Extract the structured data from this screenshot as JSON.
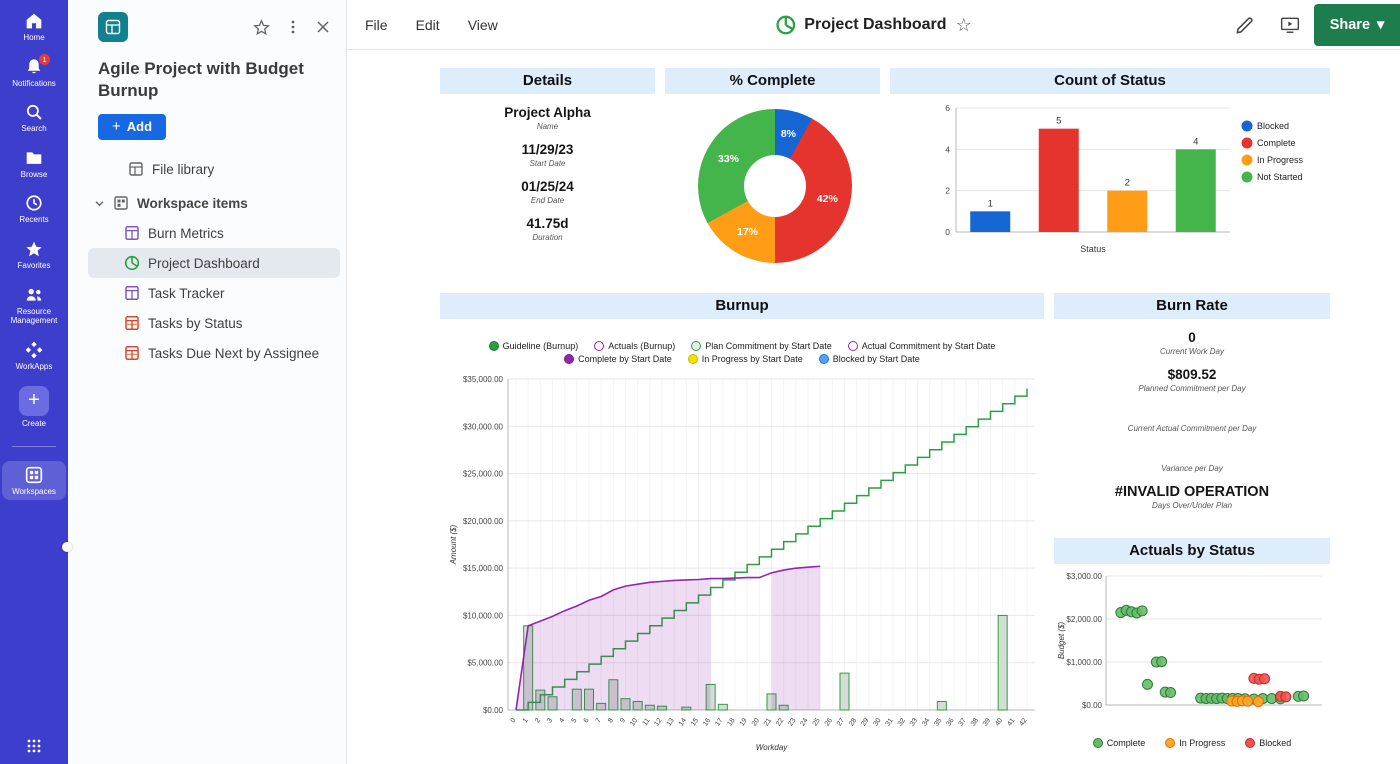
{
  "app": {
    "menu": [
      "File",
      "Edit",
      "View"
    ],
    "doc_title": "Project Dashboard",
    "share_label": "Share"
  },
  "rail": {
    "items": [
      {
        "id": "home",
        "label": "Home"
      },
      {
        "id": "notifications",
        "label": "Notifications",
        "badge": "1"
      },
      {
        "id": "search",
        "label": "Search"
      },
      {
        "id": "browse",
        "label": "Browse"
      },
      {
        "id": "recents",
        "label": "Recents"
      },
      {
        "id": "favorites",
        "label": "Favorites"
      },
      {
        "id": "resource-management",
        "label": "Resource Management"
      },
      {
        "id": "workapps",
        "label": "WorkApps"
      },
      {
        "id": "create",
        "label": "Create"
      },
      {
        "id": "workspaces",
        "label": "Workspaces"
      }
    ]
  },
  "sidebar": {
    "title": "Agile Project with Budget Burnup",
    "add_label": "Add",
    "file_library": "File library",
    "workspace_items_label": "Workspace items",
    "items": [
      {
        "label": "Burn Metrics",
        "type": "sheet"
      },
      {
        "label": "Project Dashboard",
        "type": "dashboard",
        "selected": true
      },
      {
        "label": "Task Tracker",
        "type": "sheet"
      },
      {
        "label": "Tasks by Status",
        "type": "report"
      },
      {
        "label": "Tasks Due Next by Assignee",
        "type": "report"
      }
    ]
  },
  "widgets": {
    "details": {
      "title": "Details",
      "rows": [
        {
          "value": "Project Alpha",
          "label": "Name"
        },
        {
          "value": "11/29/23",
          "label": "Start Date"
        },
        {
          "value": "01/25/24",
          "label": "End Date"
        },
        {
          "value": "41.75d",
          "label": "Duration"
        }
      ]
    },
    "percent_complete": {
      "title": "% Complete"
    },
    "count_of_status": {
      "title": "Count of Status"
    },
    "burnup": {
      "title": "Burnup"
    },
    "burn_rate": {
      "title": "Burn Rate",
      "rows": [
        {
          "value": "0",
          "label": "Current Work Day"
        },
        {
          "value": "$809.52",
          "label": "Planned Commitment per Day"
        },
        {
          "value": "",
          "label": "Current Actual Commitment per Day"
        },
        {
          "value": "",
          "label": "Variance per Day"
        },
        {
          "value": "#INVALID OPERATION",
          "label": "Days Over/Under Plan"
        }
      ]
    },
    "actuals_by_status": {
      "title": "Actuals by Status"
    }
  },
  "colors": {
    "accent_blue": "#1668e3",
    "share_green": "#1d7d4d",
    "rail_indigo": "#3e3ecd",
    "widget_header_bg": "#ddedfc"
  },
  "chart_data": [
    {
      "id": "percent-complete",
      "type": "pie",
      "title": "% Complete",
      "donut": true,
      "slices": [
        {
          "label": "8%",
          "value": 8,
          "color": "#1565d2"
        },
        {
          "label": "42%",
          "value": 42,
          "color": "#e5332d"
        },
        {
          "label": "17%",
          "value": 17,
          "color": "#ff9e16"
        },
        {
          "label": "33%",
          "value": 33,
          "color": "#43b54a"
        }
      ]
    },
    {
      "id": "count-of-status",
      "type": "bar",
      "title": "Count of Status",
      "categories": [
        "Blocked",
        "Complete",
        "In Progress",
        "Not Started"
      ],
      "values": [
        1,
        5,
        2,
        4
      ],
      "colors": [
        "#1565d2",
        "#e5332d",
        "#ff9e16",
        "#43b54a"
      ],
      "xlabel": "Status",
      "ylim": [
        0,
        6
      ],
      "yticks": [
        0,
        2,
        4,
        6
      ],
      "legend_position": "right",
      "legend": [
        {
          "label": "Blocked",
          "fill": "#1565d2",
          "stroke": "#0d4ea8"
        },
        {
          "label": "Complete",
          "fill": "#e5332d",
          "stroke": "#b02420"
        },
        {
          "label": "In Progress",
          "fill": "#ff9e16",
          "stroke": "#d07f08"
        },
        {
          "label": "Not Started",
          "fill": "#43b54a",
          "stroke": "#2e8a36"
        }
      ]
    },
    {
      "id": "burnup",
      "type": "line",
      "title": "Burnup",
      "xlabel": "Workday",
      "ylabel": "Amount ($)",
      "xlim": [
        0,
        42
      ],
      "ylim": [
        0,
        35000
      ],
      "ytick_step": 5000,
      "legend": [
        {
          "label": "Guideline (Burnup)",
          "fill": "#2e9e44",
          "stroke": "#1b7a30"
        },
        {
          "label": "Actuals (Burnup)",
          "fill": "#ffffff",
          "stroke": "#9127b0"
        },
        {
          "label": "Plan Commitment by Start Date",
          "fill": "#e7efe7",
          "stroke": "#2e9e44"
        },
        {
          "label": "Actual Commitment by Start Date",
          "fill": "#ffffff",
          "stroke": "#9127b0"
        },
        {
          "label": "Complete by Start Date",
          "fill": "#9127b0",
          "stroke": "#731f8d"
        },
        {
          "label": "In Progress by Start Date",
          "fill": "#f7df00",
          "stroke": "#cdb900"
        },
        {
          "label": "Blocked by Start Date",
          "fill": "#4da3f5",
          "stroke": "#1e78d2"
        }
      ],
      "series": [
        {
          "name": "Guideline (Burnup)",
          "style": "step",
          "color": "#2e9e44",
          "points": [
            [
              0,
              0
            ],
            [
              42,
              34000
            ]
          ]
        },
        {
          "name": "Actuals (Burnup)",
          "style": "line-area",
          "color": "#9127b0",
          "area_fill": "#9127b0",
          "area_opacity": 0.16,
          "area_ranges": [
            [
              0,
              16
            ],
            [
              21,
              25
            ]
          ],
          "points": [
            [
              0,
              0
            ],
            [
              1,
              8900
            ],
            [
              2,
              9400
            ],
            [
              3,
              9900
            ],
            [
              4,
              10500
            ],
            [
              5,
              11000
            ],
            [
              6,
              11600
            ],
            [
              7,
              12000
            ],
            [
              8,
              12700
            ],
            [
              9,
              13100
            ],
            [
              10,
              13300
            ],
            [
              11,
              13500
            ],
            [
              12,
              13600
            ],
            [
              13,
              13700
            ],
            [
              14,
              13750
            ],
            [
              15,
              13800
            ],
            [
              16,
              13900
            ],
            [
              17,
              13900
            ],
            [
              18,
              13950
            ],
            [
              19,
              14000
            ],
            [
              20,
              14000
            ],
            [
              21,
              14500
            ],
            [
              22,
              14800
            ],
            [
              23,
              15000
            ],
            [
              24,
              15100
            ],
            [
              25,
              15200
            ]
          ]
        }
      ],
      "bars": [
        {
          "x": 1,
          "y": 8900
        },
        {
          "x": 2,
          "y": 2100
        },
        {
          "x": 3,
          "y": 1400
        },
        {
          "x": 5,
          "y": 2200
        },
        {
          "x": 6,
          "y": 2200
        },
        {
          "x": 7,
          "y": 700
        },
        {
          "x": 8,
          "y": 3200
        },
        {
          "x": 9,
          "y": 1200
        },
        {
          "x": 10,
          "y": 900
        },
        {
          "x": 11,
          "y": 500
        },
        {
          "x": 12,
          "y": 400
        },
        {
          "x": 14,
          "y": 300
        },
        {
          "x": 16,
          "y": 2700
        },
        {
          "x": 17,
          "y": 600
        },
        {
          "x": 21,
          "y": 1700
        },
        {
          "x": 22,
          "y": 500
        },
        {
          "x": 27,
          "y": 3900
        },
        {
          "x": 35,
          "y": 900
        },
        {
          "x": 40,
          "y": 10000
        }
      ],
      "bar_style": {
        "stroke": "#2e9e44",
        "fill": "#ccd8cc",
        "opacity": 0.85
      }
    },
    {
      "id": "actuals-by-status",
      "type": "scatter",
      "title": "Actuals by Status",
      "ylabel": "Budget ($)",
      "ylim": [
        0,
        3000
      ],
      "yticks": [
        0,
        1000,
        2000,
        3000
      ],
      "xlim": [
        0,
        23
      ],
      "legend": [
        {
          "label": "Complete",
          "fill": "#66bb6a",
          "stroke": "#2e7d32"
        },
        {
          "label": "In Progress",
          "fill": "#ffa726",
          "stroke": "#ef6c00"
        },
        {
          "label": "Blocked",
          "fill": "#ef5350",
          "stroke": "#c62828"
        }
      ],
      "series": [
        {
          "name": "Complete",
          "fill": "#66bb6a",
          "stroke": "#2e7d32",
          "points": [
            [
              1,
              2150
            ],
            [
              1.6,
              2200
            ],
            [
              2.2,
              2170
            ],
            [
              2.8,
              2140
            ],
            [
              3.4,
              2190
            ],
            [
              4,
              480
            ],
            [
              5,
              1000
            ],
            [
              5.6,
              1010
            ],
            [
              6,
              300
            ],
            [
              6.6,
              290
            ],
            [
              10,
              160
            ],
            [
              10.6,
              150
            ],
            [
              11.2,
              155
            ],
            [
              11.8,
              150
            ],
            [
              12.4,
              160
            ],
            [
              13,
              150
            ],
            [
              13.6,
              155
            ],
            [
              14.2,
              150
            ],
            [
              15,
              145
            ],
            [
              16,
              140
            ],
            [
              17,
              150
            ],
            [
              18,
              150
            ],
            [
              19,
              145
            ],
            [
              21,
              200
            ],
            [
              21.6,
              210
            ]
          ]
        },
        {
          "name": "In Progress",
          "fill": "#ffa726",
          "stroke": "#ef6c00",
          "points": [
            [
              13.5,
              90
            ],
            [
              14.1,
              85
            ],
            [
              14.7,
              95
            ],
            [
              15.3,
              90
            ],
            [
              16.5,
              80
            ]
          ]
        },
        {
          "name": "Blocked",
          "fill": "#ef5350",
          "stroke": "#c62828",
          "points": [
            [
              16,
              620
            ],
            [
              16.6,
              600
            ],
            [
              17.2,
              610
            ],
            [
              19,
              200
            ],
            [
              19.6,
              190
            ]
          ]
        }
      ]
    }
  ]
}
